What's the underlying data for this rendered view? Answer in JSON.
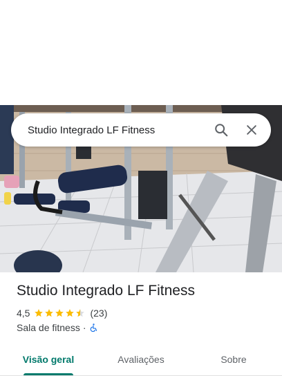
{
  "search": {
    "query": "Studio Integrado LF Fitness",
    "search_icon": "search-icon",
    "close_icon": "close-icon"
  },
  "hero": {
    "photo": "gym-equipment-photo"
  },
  "place": {
    "name": "Studio Integrado LF Fitness",
    "rating": "4,5",
    "rating_value": 4.5,
    "stars_max": 5,
    "review_count": "(23)",
    "category": "Sala de fitness",
    "separator": "·",
    "accessibility_icon": "wheelchair-accessible-icon"
  },
  "tabs": [
    {
      "label": "Visão geral",
      "active": true
    },
    {
      "label": "Avaliações",
      "active": false
    },
    {
      "label": "Sobre",
      "active": false
    }
  ],
  "colors": {
    "accent": "#00796b",
    "star": "#fbbc04",
    "star_empty": "#dadce0",
    "accessibility": "#1a73e8"
  }
}
